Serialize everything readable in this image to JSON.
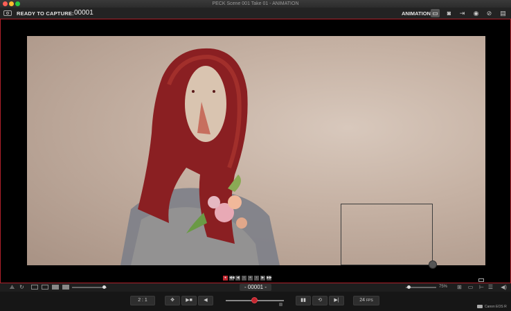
{
  "window": {
    "title": "PECK  Scene 001  Take 01 - ANIMATION",
    "traffic_lights": [
      "#ff5f57",
      "#febc2e",
      "#28c840"
    ]
  },
  "toolbar": {
    "status_label": "READY TO CAPTURE:",
    "frame_counter": "00001",
    "mode_label": "ANIMATION",
    "icons": [
      "monitor-icon",
      "camera-icon",
      "timeline-icon",
      "focus-icon",
      "no-onion-icon",
      "layers-icon"
    ]
  },
  "stage": {
    "border_color": "#b0202a",
    "image_description_icon": "capture-image"
  },
  "nav_strip": {
    "icons": [
      "record",
      "first-frame",
      "previous",
      "step-back",
      "loop",
      "play",
      "step-forward",
      "last-frame"
    ],
    "labels": [
      "●",
      "◀◀",
      "◀",
      "‹",
      "+",
      "›",
      "▶",
      "▶▶"
    ]
  },
  "controls": {
    "frame_nav_label": "- 00001 -",
    "zoom_label": "75%"
  },
  "bottom": {
    "ratio_label": "2 : 1",
    "fps_label": "24",
    "fps_unit": "FPS",
    "camera_label": "Canon EOS R"
  },
  "colors": {
    "accent": "#c2262f",
    "background": "#1a1a1a"
  }
}
